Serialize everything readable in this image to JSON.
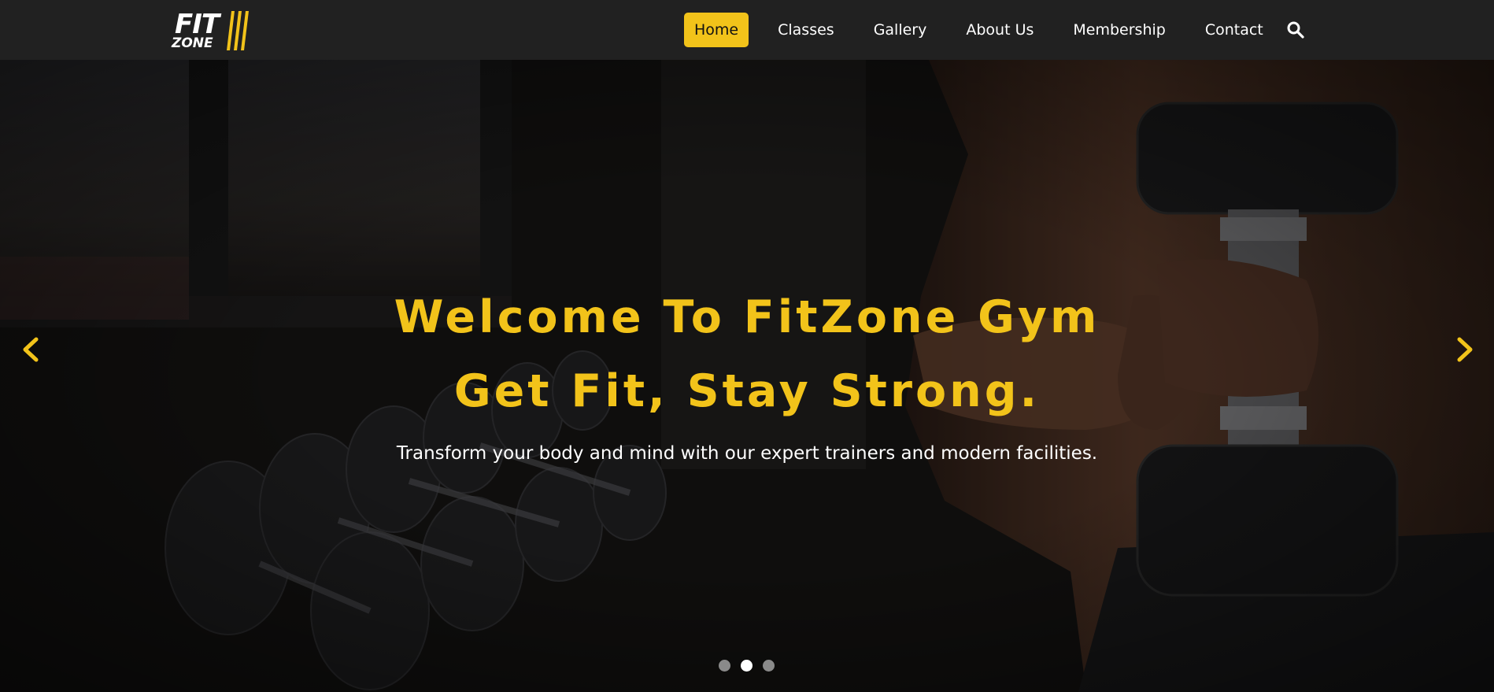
{
  "brand": {
    "line1": "FIT",
    "line2": "ZONE",
    "accent_color": "#f2c31a"
  },
  "nav": {
    "items": [
      {
        "label": "Home",
        "active": true
      },
      {
        "label": "Classes",
        "active": false
      },
      {
        "label": "Gallery",
        "active": false
      },
      {
        "label": "About Us",
        "active": false
      },
      {
        "label": "Membership",
        "active": false
      },
      {
        "label": "Contact",
        "active": false
      }
    ],
    "search_icon": "search-icon"
  },
  "hero": {
    "headline_line1": "Welcome To FitZone Gym",
    "headline_line2": "Get Fit, Stay Strong.",
    "subtitle": "Transform your body and mind with our expert trainers and modern facilities.",
    "prev_icon": "chevron-left-icon",
    "next_icon": "chevron-right-icon",
    "slides": [
      {
        "active": false
      },
      {
        "active": true
      },
      {
        "active": false
      }
    ]
  },
  "colors": {
    "navbar_bg": "#212121",
    "accent": "#f2c31a",
    "text": "#ffffff"
  }
}
